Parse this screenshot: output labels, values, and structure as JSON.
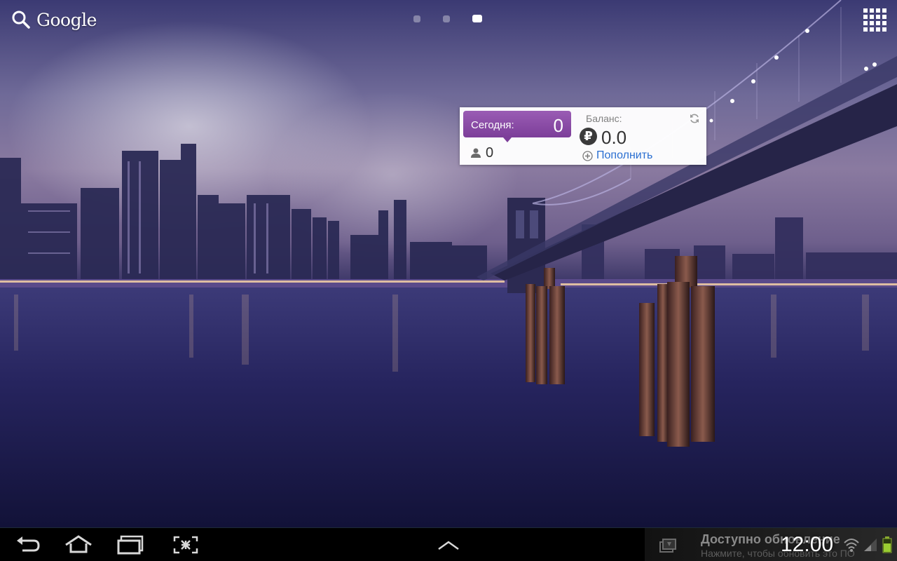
{
  "search": {
    "label": "Google",
    "icon": "search-icon"
  },
  "home_pages": {
    "count": 3,
    "active_index": 2
  },
  "apps_button": {
    "icon": "apps-grid-icon"
  },
  "widget": {
    "today_label": "Сегодня:",
    "today_value": "0",
    "contacts_count": "0",
    "balance_label": "Баланс:",
    "currency_symbol": "₽",
    "balance_value": "0.0",
    "topup_label": "Пополнить",
    "accent_color": "#8a4aa6",
    "link_color": "#2a6fd1"
  },
  "system_bar": {
    "back_icon": "back-icon",
    "home_icon": "home-icon",
    "recents_icon": "recent-apps-icon",
    "screenshot_icon": "screenshot-icon",
    "up_icon": "chevron-up-icon",
    "notification": {
      "icon": "update-icon",
      "title": "Доступно обновление",
      "subtitle": "Нажмите, чтобы обновить это ПО"
    },
    "clock": "12:00",
    "wifi_icon": "wifi-icon",
    "signal_icon": "signal-icon",
    "battery_icon": "battery-icon"
  }
}
